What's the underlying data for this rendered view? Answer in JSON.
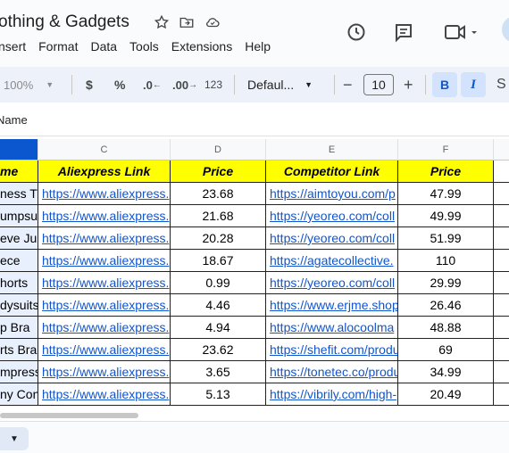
{
  "doc": {
    "title": "othing & Gadgets"
  },
  "menu": [
    "nsert",
    "Format",
    "Data",
    "Tools",
    "Extensions",
    "Help"
  ],
  "toolbar": {
    "zoom": "100%",
    "currency": "$",
    "percent": "%",
    "dec_decrease": ".0",
    "dec_increase": ".00",
    "format_123": "123",
    "font": "Defaul...",
    "font_size": "10",
    "minus": "−",
    "plus": "+",
    "bold": "B",
    "italic": "I"
  },
  "namebox": {
    "value": "Name"
  },
  "columns": [
    "C",
    "D",
    "E",
    "F"
  ],
  "header_row": {
    "name": "me",
    "aliexpress": "Aliexpress Link",
    "price1": "Price",
    "competitor": "Competitor Link",
    "price2": "Price"
  },
  "rows": [
    {
      "name": "ness Tr",
      "ali": "https://www.aliexpress.",
      "p1": "23.68",
      "comp": "https://aimtoyou.com/p",
      "p2": "47.99"
    },
    {
      "name": "umpsuit",
      "ali": "https://www.aliexpress.",
      "p1": "21.68",
      "comp": "https://yeoreo.com/coll",
      "p2": "49.99"
    },
    {
      "name": "eve Jur",
      "ali": "https://www.aliexpress.",
      "p1": "20.28",
      "comp": "https://yeoreo.com/coll",
      "p2": "51.99"
    },
    {
      "name": "ece",
      "ali": "https://www.aliexpress.",
      "p1": "18.67",
      "comp": "https://agatecollective.",
      "p2": "110"
    },
    {
      "name": "horts",
      "ali": "https://www.aliexpress.",
      "p1": "0.99",
      "comp": "https://yeoreo.com/coll",
      "p2": "29.99"
    },
    {
      "name": "dysuits",
      "ali": "https://www.aliexpress.",
      "p1": "4.46",
      "comp": "https://www.erjme.shop",
      "p2": "26.46"
    },
    {
      "name": "p Bra",
      "ali": "https://www.aliexpress.",
      "p1": "4.94",
      "comp": "https://www.alocoolma",
      "p2": "48.88"
    },
    {
      "name": "rts Bra",
      "ali": "https://www.aliexpress.",
      "p1": "23.62",
      "comp": "https://shefit.com/produ",
      "p2": "69"
    },
    {
      "name": "mpress",
      "ali": "https://www.aliexpress.",
      "p1": "3.65",
      "comp": "https://tonetec.co/produ",
      "p2": "34.99"
    },
    {
      "name": "ny Con",
      "ali": "https://www.aliexpress.",
      "p1": "5.13",
      "comp": "https://vibrily.com/high-",
      "p2": "20.49"
    }
  ]
}
